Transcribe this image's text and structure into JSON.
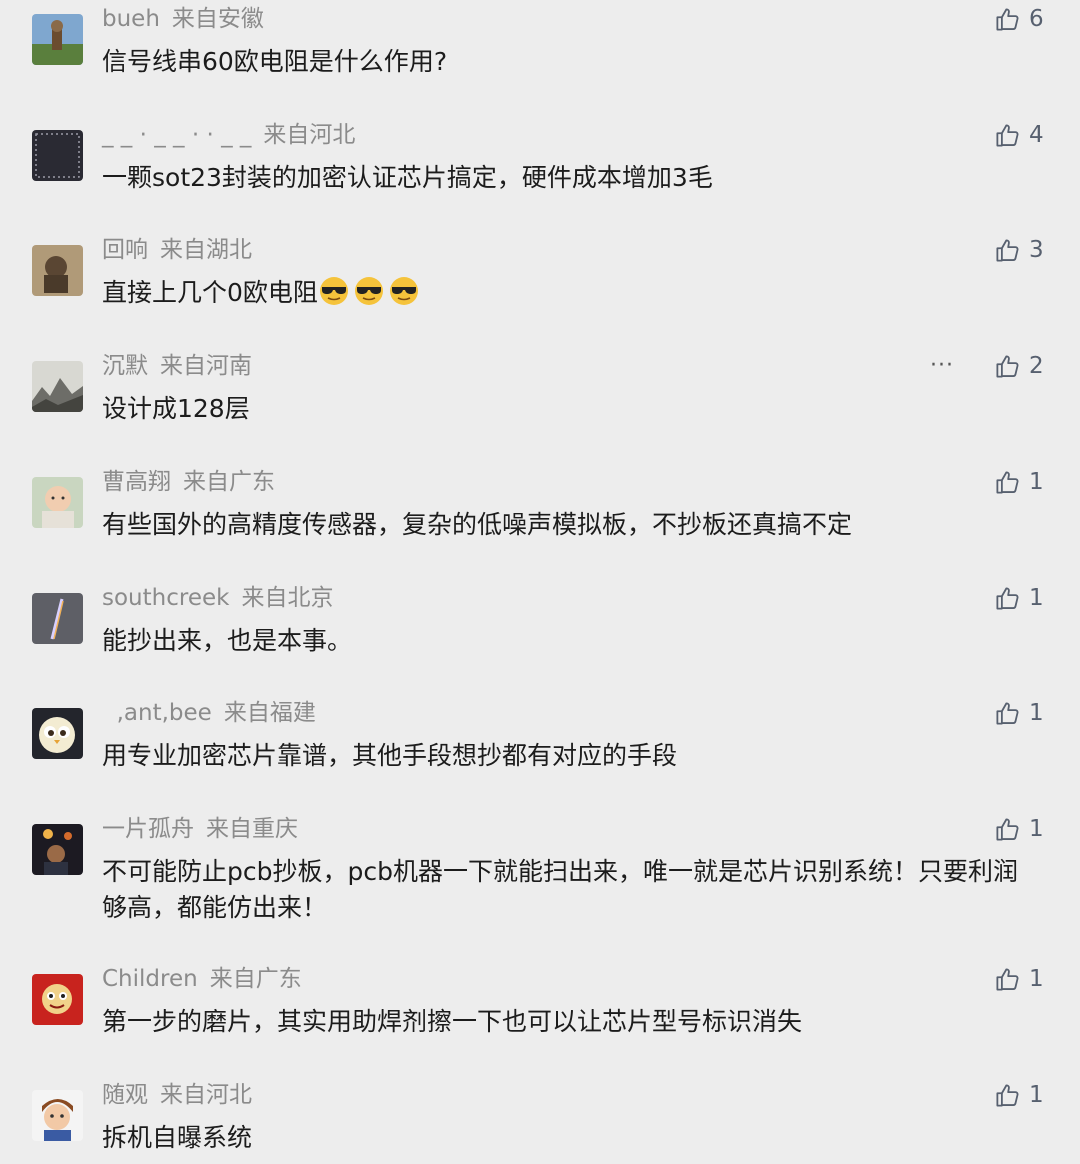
{
  "comments": [
    {
      "name": "bueh",
      "location": "来自安徽",
      "text": "信号线串60欧电阻是什么作用?",
      "likes": "6"
    },
    {
      "name": "_ _ · _ _ · · _ _",
      "location": "来自河北",
      "text": "一颗sot23封装的加密认证芯片搞定，硬件成本增加3毛",
      "likes": "4"
    },
    {
      "name": "回响",
      "location": "来自湖北",
      "text": "直接上几个0欧电阻",
      "likes": "3",
      "emoji": [
        "sunglasses-emoji",
        "sunglasses-emoji",
        "sunglasses-emoji"
      ]
    },
    {
      "name": "沉默",
      "location": "来自河南",
      "text": "设计成128层",
      "likes": "2",
      "more": "···"
    },
    {
      "name": "曹高翔",
      "location": "来自广东",
      "text": "有些国外的高精度传感器，复杂的低噪声模拟板，不抄板还真搞不定",
      "likes": "1"
    },
    {
      "name": "southcreek",
      "location": "来自北京",
      "text": "能抄出来，也是本事。",
      "likes": "1"
    },
    {
      "name": "  ,ant,bee",
      "location": "来自福建",
      "text": "用专业加密芯片靠谱，其他手段想抄都有对应的手段",
      "likes": "1"
    },
    {
      "name": "一片孤舟",
      "location": "来自重庆",
      "text": "不可能防止pcb抄板，pcb机器一下就能扫出来，唯一就是芯片识别系统！只要利润够高，都能仿出来！",
      "likes": "1"
    },
    {
      "name": "Children",
      "location": "来自广东",
      "text": "第一步的磨片，其实用助焊剂擦一下也可以让芯片型号标识消失",
      "likes": "1"
    },
    {
      "name": "随观",
      "location": "来自河北",
      "text": "拆机自曝系统",
      "likes": "1"
    }
  ],
  "icons": {
    "like": "thumbs-up-icon",
    "more": "more-options-icon"
  }
}
